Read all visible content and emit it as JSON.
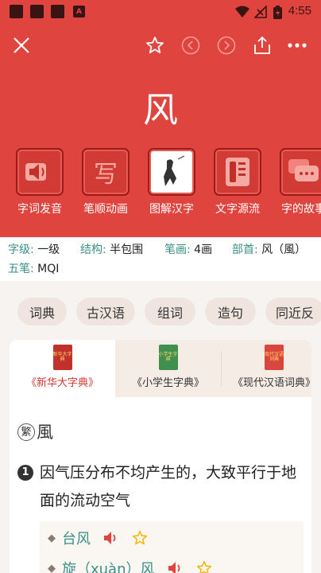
{
  "status_bar": {
    "time": "4:55",
    "badge": "A"
  },
  "header": {
    "character": "风"
  },
  "tools": [
    {
      "label": "字词发音",
      "icon": "speaker-icon"
    },
    {
      "label": "笔顺动画",
      "icon": "write-icon",
      "glyph": "写"
    },
    {
      "label": "图解汉字",
      "icon": "illustration-icon"
    },
    {
      "label": "文字源流",
      "icon": "document-icon"
    },
    {
      "label": "字的故事",
      "icon": "chat-bubble-icon"
    }
  ],
  "info": {
    "zhuji_label": "字级:",
    "zhuji": "一级",
    "jiegou_label": "结构:",
    "jiegou": "半包围",
    "bihua_label": "笔画:",
    "bihua": "4画",
    "bushou_label": "部首:",
    "bushou": "风（風）",
    "wubi_label": "五笔:",
    "wubi": "MQI"
  },
  "chips": [
    "词典",
    "古汉语",
    "组词",
    "造句",
    "同近反"
  ],
  "dict_tabs": [
    {
      "label": "《新华大字典》",
      "cover": "新华大字典",
      "active": true
    },
    {
      "label": "《小学生字典》",
      "cover": "小学生字典",
      "active": false
    },
    {
      "label": "《现代汉语词典》",
      "cover": "现代汉语词典",
      "active": false
    }
  ],
  "entry": {
    "trad_mark": "繁",
    "traditional": "風",
    "sense_number": "1",
    "definition": "因气压分布不均产生的，大致平行于地面的流动空气",
    "words": [
      {
        "text": "台风"
      },
      {
        "text": "旋（xuàn）风"
      }
    ]
  },
  "colors": {
    "primary_red": "#e0443f",
    "teal": "#3b8f86",
    "star": "#f4b400"
  }
}
